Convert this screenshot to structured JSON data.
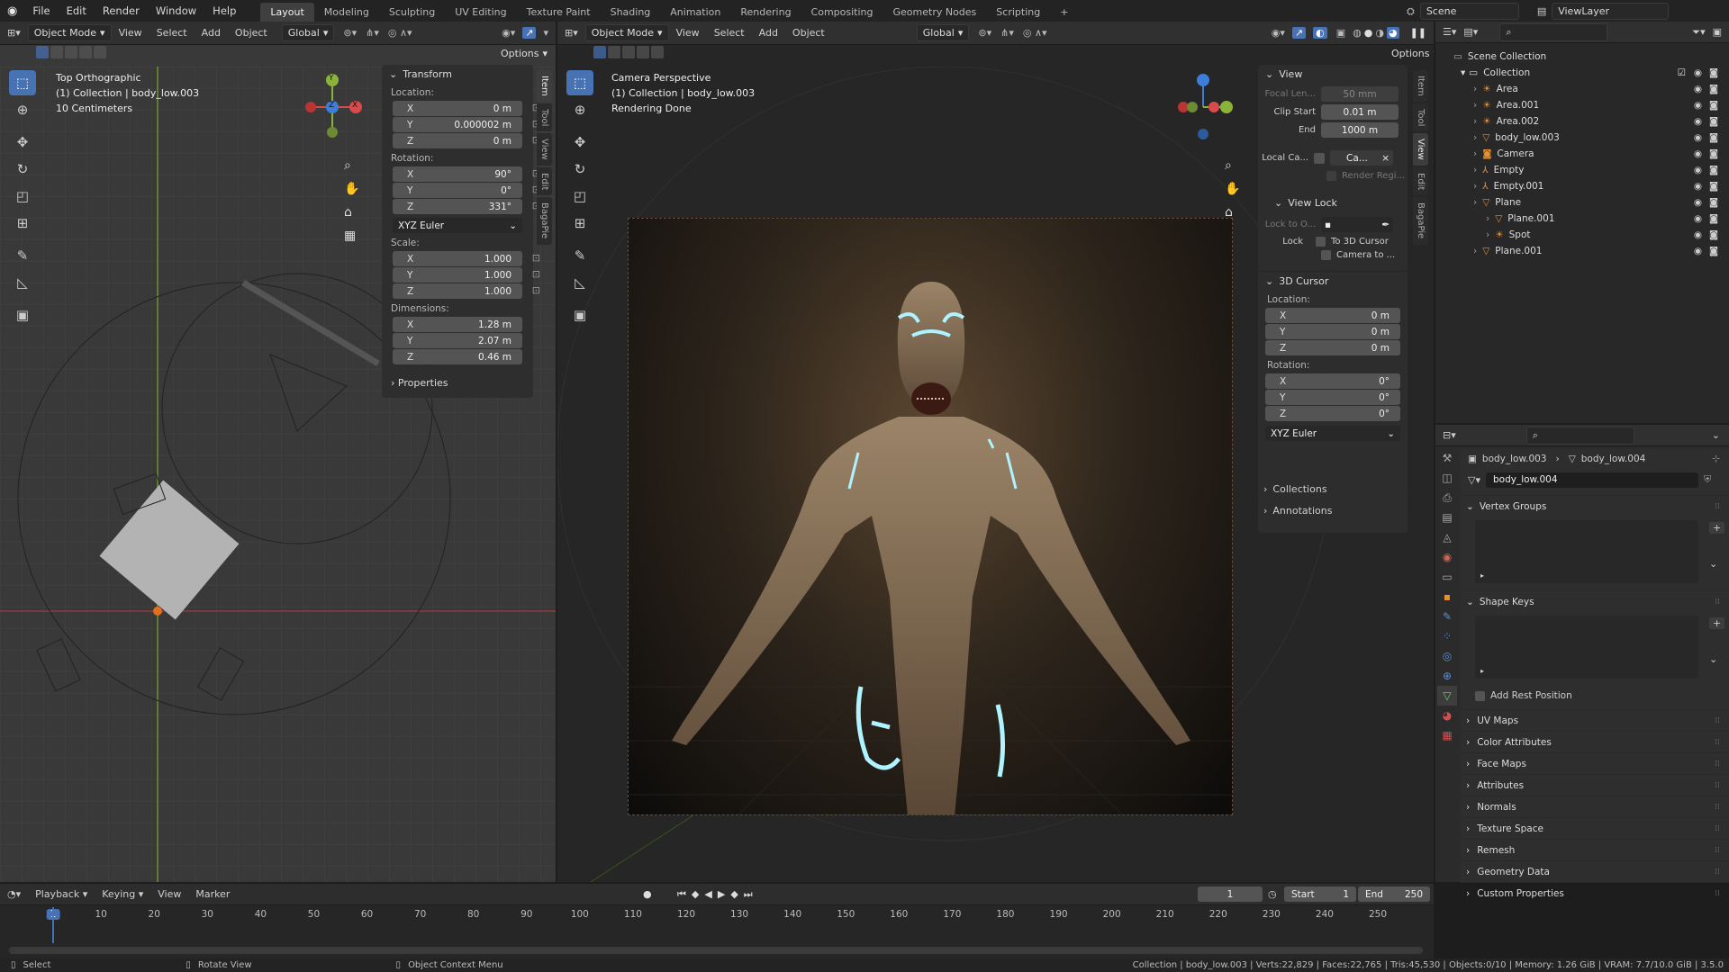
{
  "menubar": {
    "items": [
      "File",
      "Edit",
      "Render",
      "Window",
      "Help"
    ],
    "workspaces": [
      "Layout",
      "Modeling",
      "Sculpting",
      "UV Editing",
      "Texture Paint",
      "Shading",
      "Animation",
      "Rendering",
      "Compositing",
      "Geometry Nodes",
      "Scripting"
    ],
    "active_workspace": "Layout",
    "add_tab": "+",
    "scene": "Scene",
    "view_layer": "ViewLayer"
  },
  "left_view": {
    "mode": "Object Mode",
    "menus": [
      "View",
      "Select",
      "Add",
      "Object"
    ],
    "orientation": "Global",
    "options": "Options",
    "overlay": [
      "Top Orthographic",
      "(1) Collection | body_low.003",
      "10 Centimeters"
    ],
    "gizmo": {
      "y": "Y",
      "z": "Z",
      "x": "X"
    }
  },
  "transform": {
    "title": "Transform",
    "location_label": "Location:",
    "location": [
      {
        "k": "X",
        "v": "0 m"
      },
      {
        "k": "Y",
        "v": "0.000002 m"
      },
      {
        "k": "Z",
        "v": "0 m"
      }
    ],
    "rotation_label": "Rotation:",
    "rotation": [
      {
        "k": "X",
        "v": "90°"
      },
      {
        "k": "Y",
        "v": "0°"
      },
      {
        "k": "Z",
        "v": "331°"
      }
    ],
    "rotation_mode": "XYZ Euler",
    "scale_label": "Scale:",
    "scale": [
      {
        "k": "X",
        "v": "1.000"
      },
      {
        "k": "Y",
        "v": "1.000"
      },
      {
        "k": "Z",
        "v": "1.000"
      }
    ],
    "dimensions_label": "Dimensions:",
    "dimensions": [
      {
        "k": "X",
        "v": "1.28 m"
      },
      {
        "k": "Y",
        "v": "2.07 m"
      },
      {
        "k": "Z",
        "v": "0.46 m"
      }
    ],
    "properties": "Properties"
  },
  "left_tabs": [
    "Item",
    "Tool",
    "View",
    "Edit",
    "BagaPie"
  ],
  "right_view": {
    "mode": "Object Mode",
    "menus": [
      "View",
      "Select",
      "Add",
      "Object"
    ],
    "orientation": "Global",
    "options": "Options",
    "overlay": [
      "Camera Perspective",
      "(1) Collection | body_low.003",
      "Rendering Done"
    ]
  },
  "view_panel": {
    "title": "View",
    "focal_label": "Focal Len...",
    "focal": "50 mm",
    "clip_start_label": "Clip Start",
    "clip_start": "0.01 m",
    "end_label": "End",
    "end": "1000 m",
    "local_cam_label": "Local Ca...",
    "local_cam": "Ca...",
    "render_region": "Render Regi...",
    "view_lock": "View Lock",
    "lock_to_obj": "Lock to O...",
    "lock_label": "Lock",
    "to_3d_cursor": "To 3D Cursor",
    "camera_to": "Camera to ..."
  },
  "cursor_panel": {
    "title": "3D Cursor",
    "location_label": "Location:",
    "location": [
      {
        "k": "X",
        "v": "0 m"
      },
      {
        "k": "Y",
        "v": "0 m"
      },
      {
        "k": "Z",
        "v": "0 m"
      }
    ],
    "rotation_label": "Rotation:",
    "rotation": [
      {
        "k": "X",
        "v": "0°"
      },
      {
        "k": "Y",
        "v": "0°"
      },
      {
        "k": "Z",
        "v": "0°"
      }
    ],
    "rotation_mode": "XYZ Euler"
  },
  "extra_panels": [
    "Collections",
    "Annotations"
  ],
  "right_tabs": [
    "Item",
    "Tool",
    "View",
    "Edit",
    "BagaPie"
  ],
  "outliner": {
    "root": "Scene Collection",
    "collection": "Collection",
    "rows": [
      {
        "name": "Area",
        "indent": 2,
        "icon": "light"
      },
      {
        "name": "Area.001",
        "indent": 2,
        "icon": "light"
      },
      {
        "name": "Area.002",
        "indent": 2,
        "icon": "light"
      },
      {
        "name": "body_low.003",
        "indent": 2,
        "icon": "mesh"
      },
      {
        "name": "Camera",
        "indent": 2,
        "icon": "camera"
      },
      {
        "name": "Empty",
        "indent": 2,
        "icon": "empty"
      },
      {
        "name": "Empty.001",
        "indent": 2,
        "icon": "empty"
      },
      {
        "name": "Plane",
        "indent": 2,
        "icon": "mesh"
      },
      {
        "name": "Plane.001",
        "indent": 3,
        "icon": "mesh"
      },
      {
        "name": "Spot",
        "indent": 3,
        "icon": "light"
      },
      {
        "name": "Plane.001",
        "indent": 2,
        "icon": "mesh"
      }
    ]
  },
  "properties": {
    "breadcrumb_obj": "body_low.003",
    "breadcrumb_data": "body_low.004",
    "data_name": "body_low.004",
    "vertex_groups": "Vertex Groups",
    "shape_keys": "Shape Keys",
    "add_rest_position": "Add Rest Position",
    "sections": [
      "UV Maps",
      "Color Attributes",
      "Face Maps",
      "Attributes",
      "Normals",
      "Texture Space",
      "Remesh",
      "Geometry Data",
      "Custom Properties"
    ]
  },
  "timeline": {
    "menus": [
      "Playback",
      "Keying",
      "View",
      "Marker"
    ],
    "current_frame": "1",
    "start_label": "Start",
    "start": "1",
    "end_label": "End",
    "end": "250",
    "ticks": [
      "1",
      "10",
      "20",
      "30",
      "40",
      "50",
      "60",
      "70",
      "80",
      "90",
      "100",
      "110",
      "120",
      "130",
      "140",
      "150",
      "160",
      "170",
      "180",
      "190",
      "200",
      "210",
      "220",
      "230",
      "240",
      "250"
    ]
  },
  "statusbar": {
    "select": "Select",
    "rotate": "Rotate View",
    "context": "Object Context Menu",
    "stats": "Collection | body_low.003 | Verts:22,829 | Faces:22,765 | Tris:45,530 | Objects:0/10 | Memory: 1.26 GiB | VRAM: 7.7/10.0 GiB | 3.5.0"
  }
}
